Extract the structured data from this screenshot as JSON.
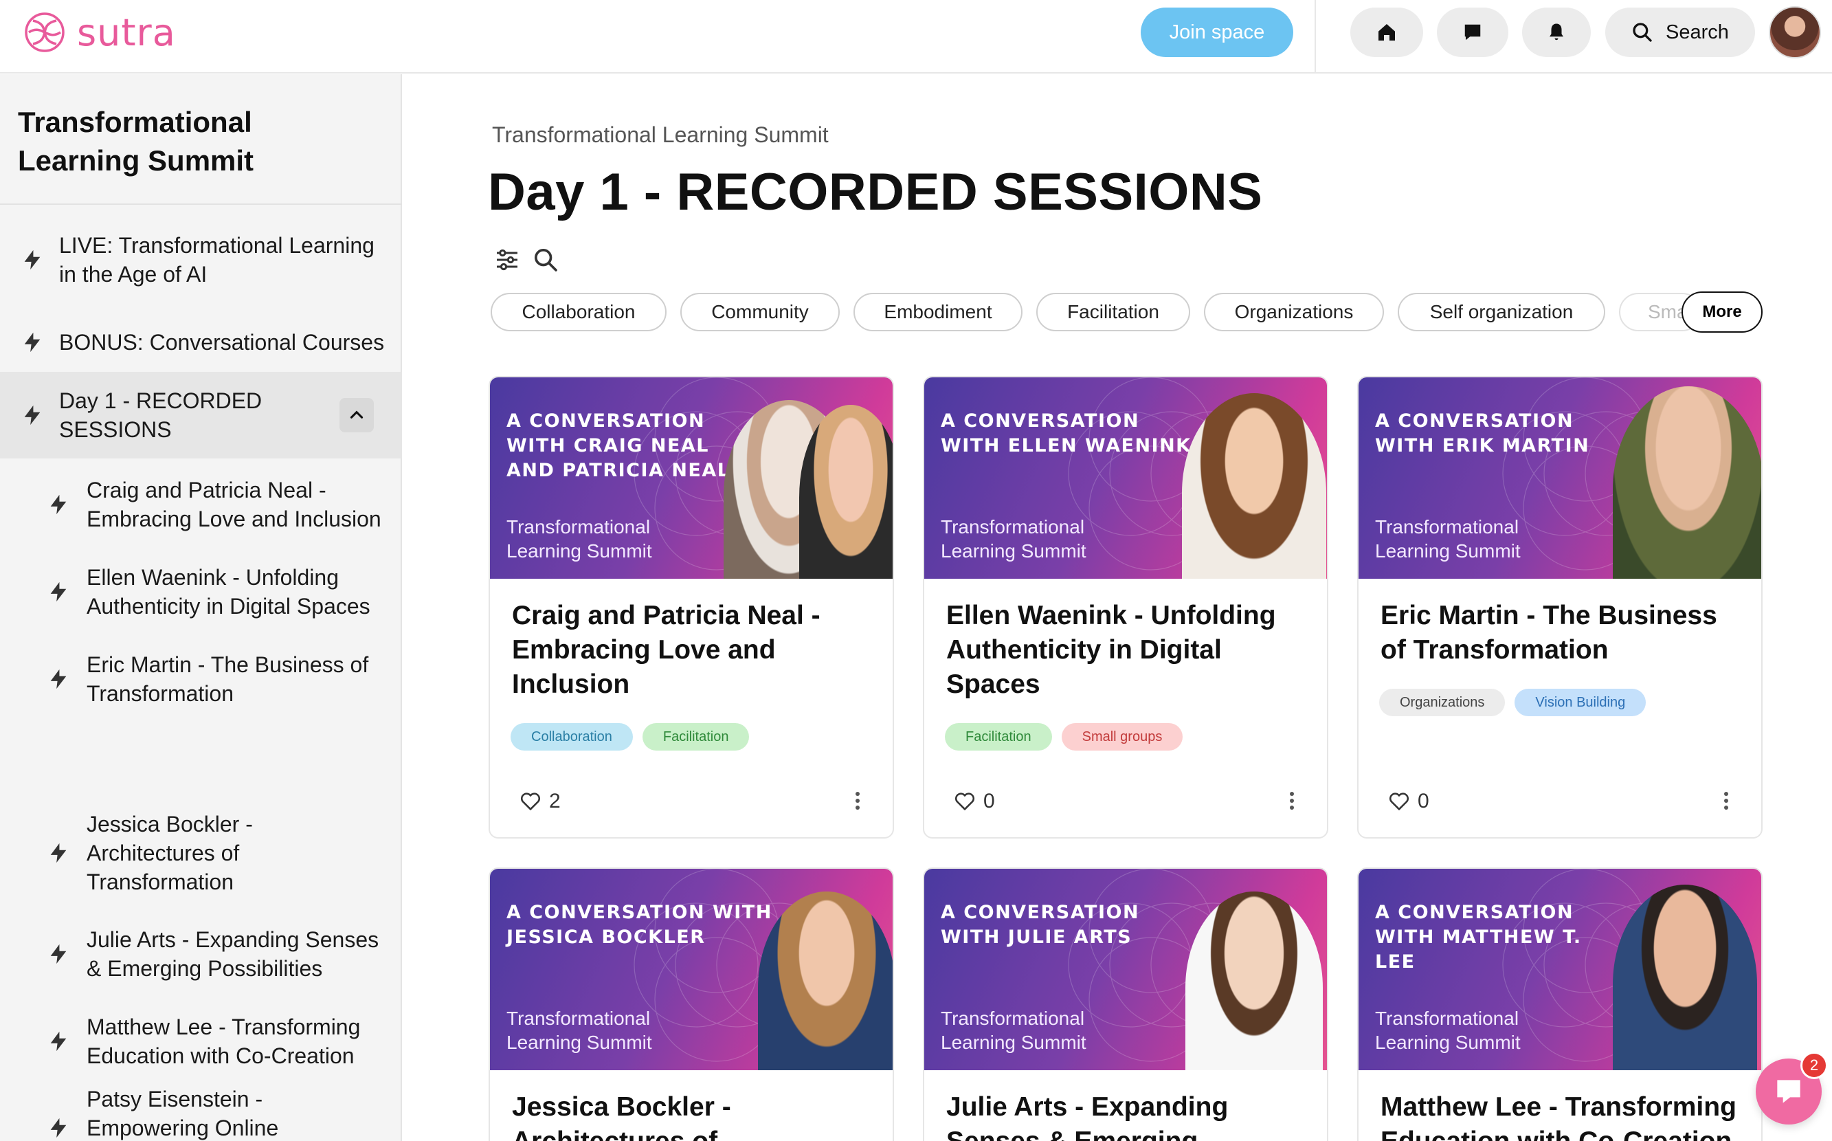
{
  "app": {
    "name": "sutra"
  },
  "header": {
    "join_label": "Join space",
    "search_label": "Search"
  },
  "sidebar": {
    "space_title": "Transformational Learning Summit",
    "items": [
      {
        "label": "LIVE: Transformational Learning in the Age of AI"
      },
      {
        "label": "BONUS: Conversational Courses"
      },
      {
        "label": "Day 1 - RECORDED SESSIONS",
        "expanded": true
      },
      {
        "label": "Craig and Patricia Neal - Embracing Love and Inclusion"
      },
      {
        "label": "Ellen Waenink - Unfolding Authenticity in Digital Spaces"
      },
      {
        "label": "Eric Martin - The Business of Transformation"
      },
      {
        "label": "Jessica Bockler - Architectures of Transformation"
      },
      {
        "label": "Julie Arts - Expanding Senses & Emerging Possibilities"
      },
      {
        "label": "Matthew Lee - Transforming Education with Co-Creation"
      },
      {
        "label": "Patsy Eisenstein - Empowering Online Communities"
      }
    ]
  },
  "main": {
    "breadcrumb": "Transformational Learning Summit",
    "title": "Day 1 - RECORDED SESSIONS",
    "filters": [
      "Collaboration",
      "Community",
      "Embodiment",
      "Facilitation",
      "Organizations",
      "Self organization",
      "Sma"
    ],
    "more_label": "More",
    "thumb_brand": "Transformational Learning Summit",
    "cards": [
      {
        "heading": "A conversation with Craig Neal and Patricia Neal",
        "title": "Craig and Patricia Neal - Embracing Love and Inclusion",
        "tags": [
          "Collaboration",
          "Facilitation"
        ],
        "likes": "2"
      },
      {
        "heading": "A conversation with Ellen Waenink",
        "title": "Ellen Waenink - Unfolding Authenticity in Digital Spaces",
        "tags": [
          "Facilitation",
          "Small groups"
        ],
        "likes": "0"
      },
      {
        "heading": "A conversation with Erik Martin",
        "title": "Eric Martin - The Business of Transformation",
        "tags": [
          "Organizations",
          "Vision Building"
        ],
        "likes": "0"
      },
      {
        "heading": "A conversation with Jessica Bockler",
        "title": "Jessica Bockler - Architectures of Transformation"
      },
      {
        "heading": "A conversation with Julie Arts",
        "title": "Julie Arts - Expanding Senses & Emerging Possibilities"
      },
      {
        "heading": "A conversation with Matthew T. Lee",
        "title": "Matthew Lee - Transforming Education with Co-Creation"
      }
    ]
  },
  "tag_colors": {
    "Collaboration": {
      "bg": "#bfe6f5",
      "fg": "#2a7fa5"
    },
    "Facilitation": {
      "bg": "#c9f0c9",
      "fg": "#2f8a3a"
    },
    "Small groups": {
      "bg": "#fcd0d0",
      "fg": "#c23a3a"
    },
    "Organizations": {
      "bg": "#ececec",
      "fg": "#444444"
    },
    "Vision Building": {
      "bg": "#c4e0fb",
      "fg": "#2b6fb5"
    }
  },
  "chat": {
    "badge": "2"
  },
  "colors": {
    "brand": "#e85a9b",
    "join": "#6cc4f2"
  }
}
